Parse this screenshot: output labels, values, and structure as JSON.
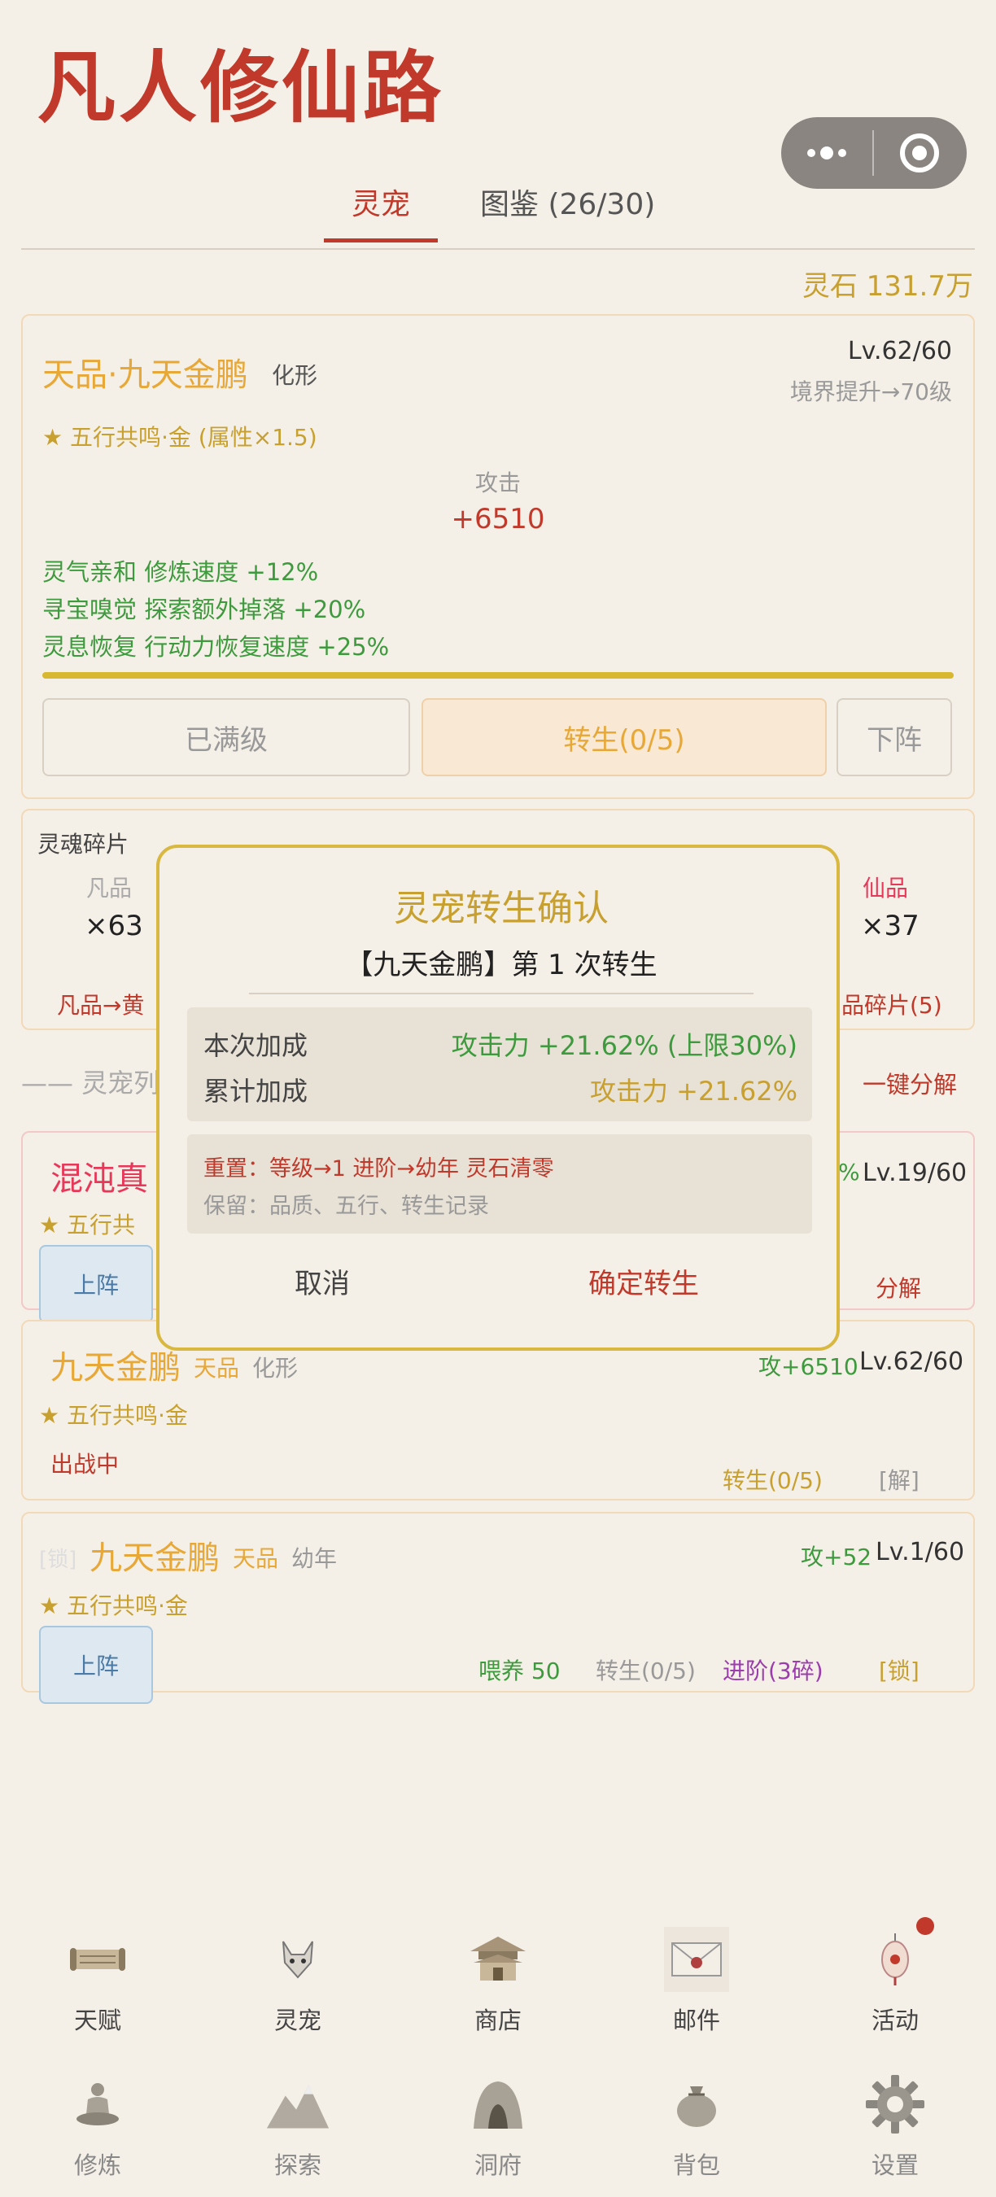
{
  "app": {
    "title": "凡人修仙路"
  },
  "tabs": [
    {
      "label": "灵宠"
    },
    {
      "label": "图鉴 (26/30)"
    }
  ],
  "currency": {
    "stones": "灵石 131.7万"
  },
  "active_pet": {
    "name": "天品·九天金鹏",
    "form": "化形",
    "level": "Lv.62/60",
    "upgrade_hint": "境界提升→70级",
    "resonance": "★ 五行共鸣·金 (属性×1.5)",
    "attack_label": "攻击",
    "attack_value": "+6510",
    "skills": [
      "灵气亲和 修炼速度 +12%",
      "寻宝嗅觉 探索额外掉落 +20%",
      "灵息恢复 行动力恢复速度 +25%"
    ],
    "xp_progress": 1.0,
    "buttons": {
      "maxed": "已满级",
      "rebirth": "转生(0/5)",
      "unequip": "下阵"
    }
  },
  "soul_fragments": {
    "title": "灵魂碎片",
    "left": {
      "tier": "凡品",
      "count": "×63",
      "convert": "凡品→黄"
    },
    "right": {
      "tier": "仙品",
      "count": "×37",
      "convert": "品碎片(5)"
    }
  },
  "pet_list": {
    "header": "—— 灵宠列",
    "bulk_decompose": "一键分解",
    "items": [
      {
        "name": "混沌真",
        "resonance": "★ 五行共",
        "level": "Lv.19/60",
        "atk_suffix": "%",
        "equip": "上阵",
        "decompose": "分解"
      },
      {
        "name": "九天金鹏",
        "tier": "天品",
        "form": "化形",
        "attack": "攻+6510",
        "level": "Lv.62/60",
        "resonance": "★ 五行共鸣·金",
        "status": "出战中",
        "rebirth": "转生(0/5)",
        "decompose": "[解]"
      },
      {
        "lock_tag": "[锁]",
        "name": "九天金鹏",
        "tier": "天品",
        "form": "幼年",
        "attack": "攻+52",
        "level": "Lv.1/60",
        "resonance": "★ 五行共鸣·金",
        "equip": "上阵",
        "feed": "喂养 50",
        "rebirth": "转生(0/5)",
        "advance": "进阶(3碎)",
        "lock": "[锁]"
      }
    ]
  },
  "modal": {
    "title": "灵宠转生确认",
    "subtitle": "【九天金鹏】第 1 次转生",
    "current_label": "本次加成",
    "current_value": "攻击力 +21.62% (上限30%)",
    "total_label": "累计加成",
    "total_value": "攻击力 +21.62%",
    "reset_text": "重置：等级→1  进阶→幼年  灵石清零",
    "keep_text": "保留：品质、五行、转生记录",
    "cancel": "取消",
    "confirm": "确定转生"
  },
  "nav": {
    "row1": [
      {
        "label": "天赋",
        "icon": "scroll-icon"
      },
      {
        "label": "灵宠",
        "icon": "fox-icon"
      },
      {
        "label": "商店",
        "icon": "pavilion-icon"
      },
      {
        "label": "邮件",
        "icon": "envelope-icon"
      },
      {
        "label": "活动",
        "icon": "lantern-icon"
      }
    ],
    "row2": [
      {
        "label": "修炼",
        "icon": "meditation-icon"
      },
      {
        "label": "探索",
        "icon": "mountain-icon"
      },
      {
        "label": "洞府",
        "icon": "cave-icon"
      },
      {
        "label": "背包",
        "icon": "bag-icon"
      },
      {
        "label": "设置",
        "icon": "gear-icon"
      }
    ]
  }
}
